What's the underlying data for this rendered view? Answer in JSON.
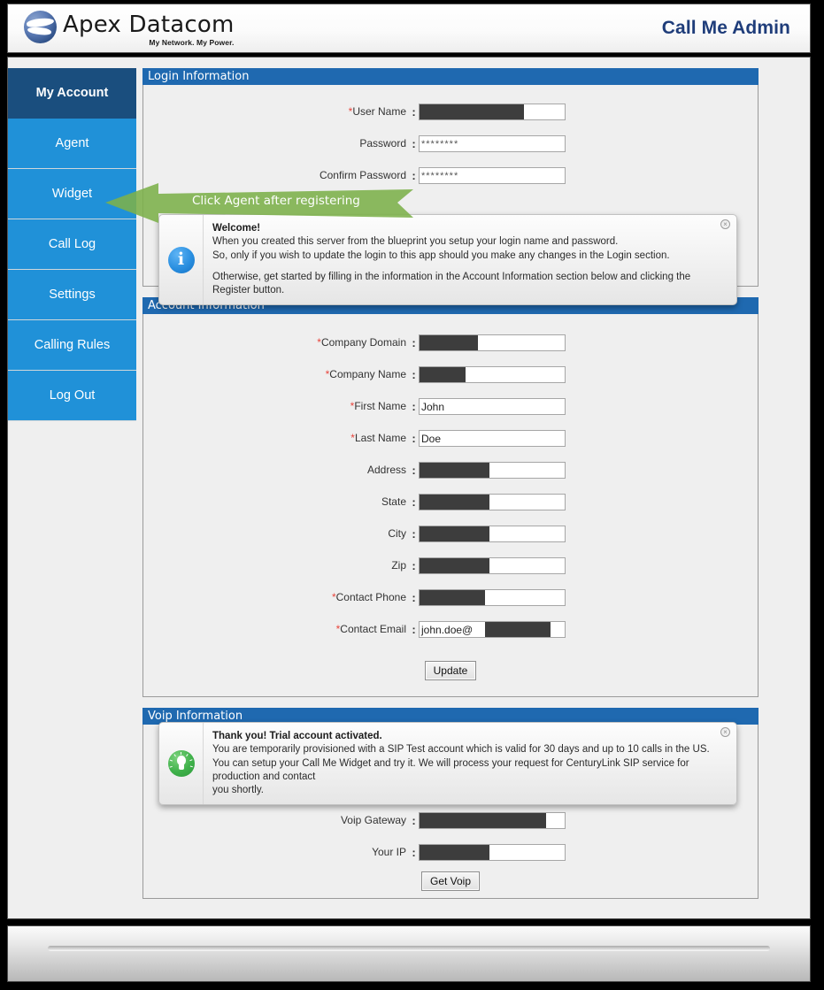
{
  "header": {
    "brand_name": "Apex Datacom",
    "brand_tagline": "My Network. My Power.",
    "app_title": "Call Me Admin",
    "logo_icon": "apex-swoosh-logo-icon"
  },
  "sidebar": {
    "items": [
      {
        "label": "My Account",
        "active": true
      },
      {
        "label": "Agent",
        "active": false
      },
      {
        "label": "Widget",
        "active": false
      },
      {
        "label": "Call Log",
        "active": false
      },
      {
        "label": "Settings",
        "active": false
      },
      {
        "label": "Calling Rules",
        "active": false
      },
      {
        "label": "Log Out",
        "active": false
      }
    ]
  },
  "annotation": {
    "text": "Click Agent after registering",
    "color": "#7CB04A",
    "direction": "left"
  },
  "login_section": {
    "title": "Login Information",
    "fields": [
      {
        "label": "User Name",
        "required": true,
        "value": "",
        "redacted": true,
        "redact_pct": 72
      },
      {
        "label": "Password",
        "required": false,
        "value": "********",
        "redacted": false,
        "redact_pct": 0
      },
      {
        "label": "Confirm Password",
        "required": false,
        "value": "********",
        "redacted": false,
        "redact_pct": 0
      }
    ],
    "callout": {
      "icon": "info-icon",
      "title": "Welcome!",
      "line1": "When you created this server from the blueprint you setup your login name and password.",
      "line2": "So, only if you wish to update the login to this app should you make any changes in the Login section.",
      "line3": "Otherwise, get started by filling in the information in the Account Information section below and clicking the Register button.",
      "close_label": "×"
    }
  },
  "account_section": {
    "title": "Account Information",
    "fields": [
      {
        "label": "Company Domain",
        "required": true,
        "value": "",
        "redacted": true,
        "redact_pct": 40
      },
      {
        "label": "Company Name",
        "required": true,
        "value": "",
        "redacted": true,
        "redact_pct": 32
      },
      {
        "label": "First Name",
        "required": true,
        "value": "John",
        "redacted": false,
        "redact_pct": 0
      },
      {
        "label": "Last Name",
        "required": true,
        "value": "Doe",
        "redacted": false,
        "redact_pct": 0
      },
      {
        "label": "Address",
        "required": false,
        "value": "",
        "redacted": true,
        "redact_pct": 48
      },
      {
        "label": "State",
        "required": false,
        "value": "",
        "redacted": true,
        "redact_pct": 48
      },
      {
        "label": "City",
        "required": false,
        "value": "",
        "redacted": true,
        "redact_pct": 48
      },
      {
        "label": "Zip",
        "required": false,
        "value": "",
        "redacted": true,
        "redact_pct": 48
      },
      {
        "label": "Contact Phone",
        "required": true,
        "value": "",
        "redacted": true,
        "redact_pct": 45
      },
      {
        "label": "Contact Email",
        "required": true,
        "value": "john.doe@",
        "redacted": true,
        "redact_pct": 45,
        "redact_offset_pct": 45
      }
    ],
    "submit_label": "Update"
  },
  "voip_section": {
    "title": "Voip Information",
    "fields": [
      {
        "label": "Voip Gateway",
        "required": false,
        "value": "",
        "redacted": true,
        "redact_pct": 87
      },
      {
        "label": "Your IP",
        "required": false,
        "value": "",
        "redacted": true,
        "redact_pct": 48
      }
    ],
    "submit_label": "Get Voip",
    "callout": {
      "icon": "lightbulb-icon",
      "title": "Thank you! Trial account activated.",
      "line1": "You are temporarily provisioned with a SIP Test account which is valid for 30 days and up to 10 calls in the US.",
      "line2": "You can setup your Call Me Widget and try it. We will process your request for CenturyLink SIP service for production and contact",
      "line3": "you shortly.",
      "close_label": "×"
    }
  },
  "colors": {
    "panel_header": "#1F69B0",
    "nav": "#2091D8",
    "nav_active": "#1A4E7E",
    "accent_title": "#1F3D7A",
    "required_star": "#e8453c",
    "annotation_green": "#7CB04A"
  }
}
